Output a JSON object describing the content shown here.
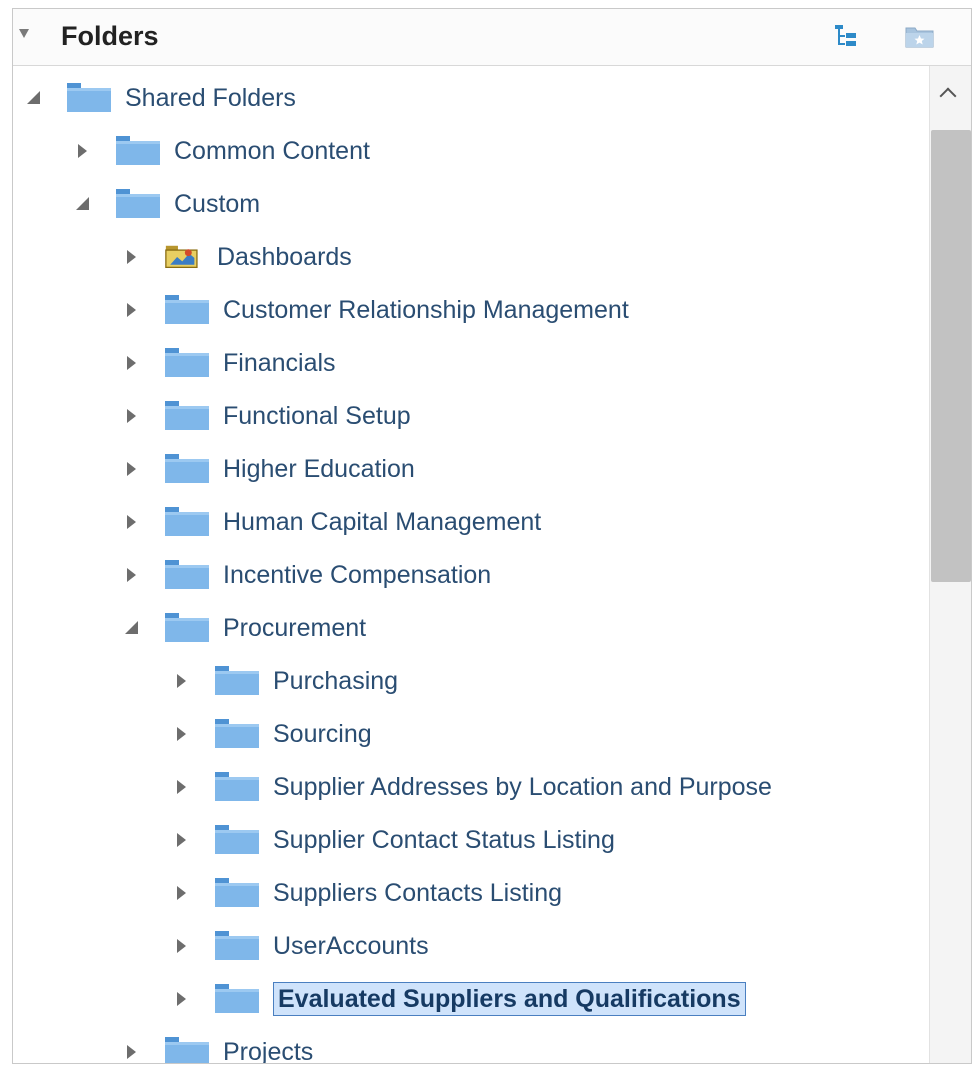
{
  "panel": {
    "title": "Folders",
    "toolbar": {
      "tree_view_icon": "tree-view-icon",
      "new_folder_icon": "new-folder-icon"
    }
  },
  "tree": {
    "shared_folders": "Shared Folders",
    "common_content": "Common Content",
    "custom": "Custom",
    "dashboards": "Dashboards",
    "crm": "Customer Relationship Management",
    "financials": "Financials",
    "functional_setup": "Functional Setup",
    "higher_education": "Higher Education",
    "hcm": "Human Capital Management",
    "incentive_compensation": "Incentive Compensation",
    "procurement": "Procurement",
    "purchasing": "Purchasing",
    "sourcing": "Sourcing",
    "supplier_addresses": "Supplier Addresses by Location and Purpose",
    "supplier_contact_status": "Supplier Contact Status Listing",
    "suppliers_contacts": "Suppliers Contacts Listing",
    "user_accounts": "UserAccounts",
    "evaluated_suppliers": "Evaluated Suppliers and Qualifications",
    "projects": "Projects"
  },
  "colors": {
    "folder": "#7fb7ea",
    "folder_dark": "#4f93d4",
    "selection_border": "#4a7fc0",
    "selection_fill": "#cfe3fb"
  }
}
